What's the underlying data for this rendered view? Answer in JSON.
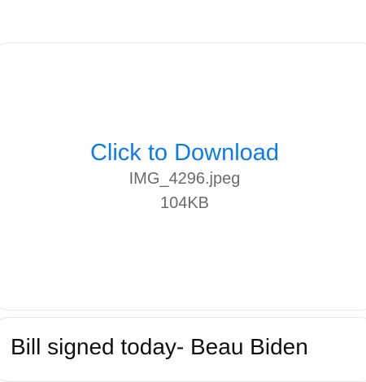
{
  "attachment": {
    "link_label": "Click to Download",
    "file_name": "IMG_4296.jpeg",
    "file_size": "104KB"
  },
  "message": {
    "text": "Bill signed today- Beau Biden"
  },
  "colors": {
    "link": "#0a7cf0",
    "meta_text": "#6b6b6b",
    "body_text": "#111111",
    "card_border": "#e6e6e6"
  }
}
